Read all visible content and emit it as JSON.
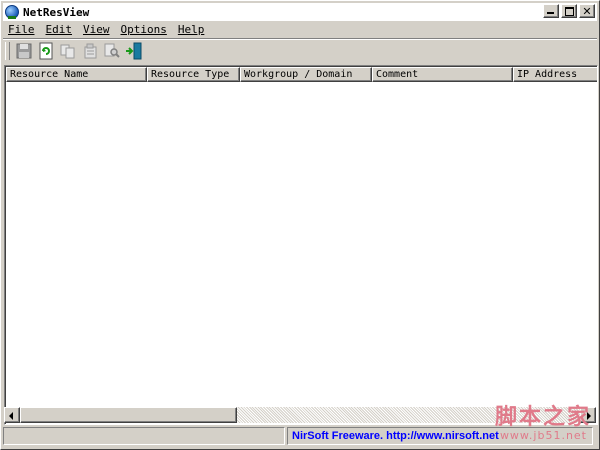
{
  "window": {
    "title": "NetResView"
  },
  "menu": {
    "items": [
      {
        "label": "File"
      },
      {
        "label": "Edit"
      },
      {
        "label": "View"
      },
      {
        "label": "Options"
      },
      {
        "label": "Help"
      }
    ]
  },
  "toolbar": {
    "buttons": [
      {
        "icon": "save-icon"
      },
      {
        "icon": "refresh-icon"
      },
      {
        "icon": "copy-icon"
      },
      {
        "icon": "properties-icon"
      },
      {
        "icon": "find-icon"
      },
      {
        "icon": "exit-icon"
      }
    ]
  },
  "table": {
    "columns": [
      "Resource Name",
      "Resource Type",
      "Workgroup / Domain",
      "Comment",
      "IP Address"
    ],
    "rows": []
  },
  "status": {
    "left": "",
    "right": "NirSoft Freeware.  http://www.nirsoft.net"
  },
  "watermark": {
    "text": "脚本之家",
    "url": "www.jb51.net"
  }
}
